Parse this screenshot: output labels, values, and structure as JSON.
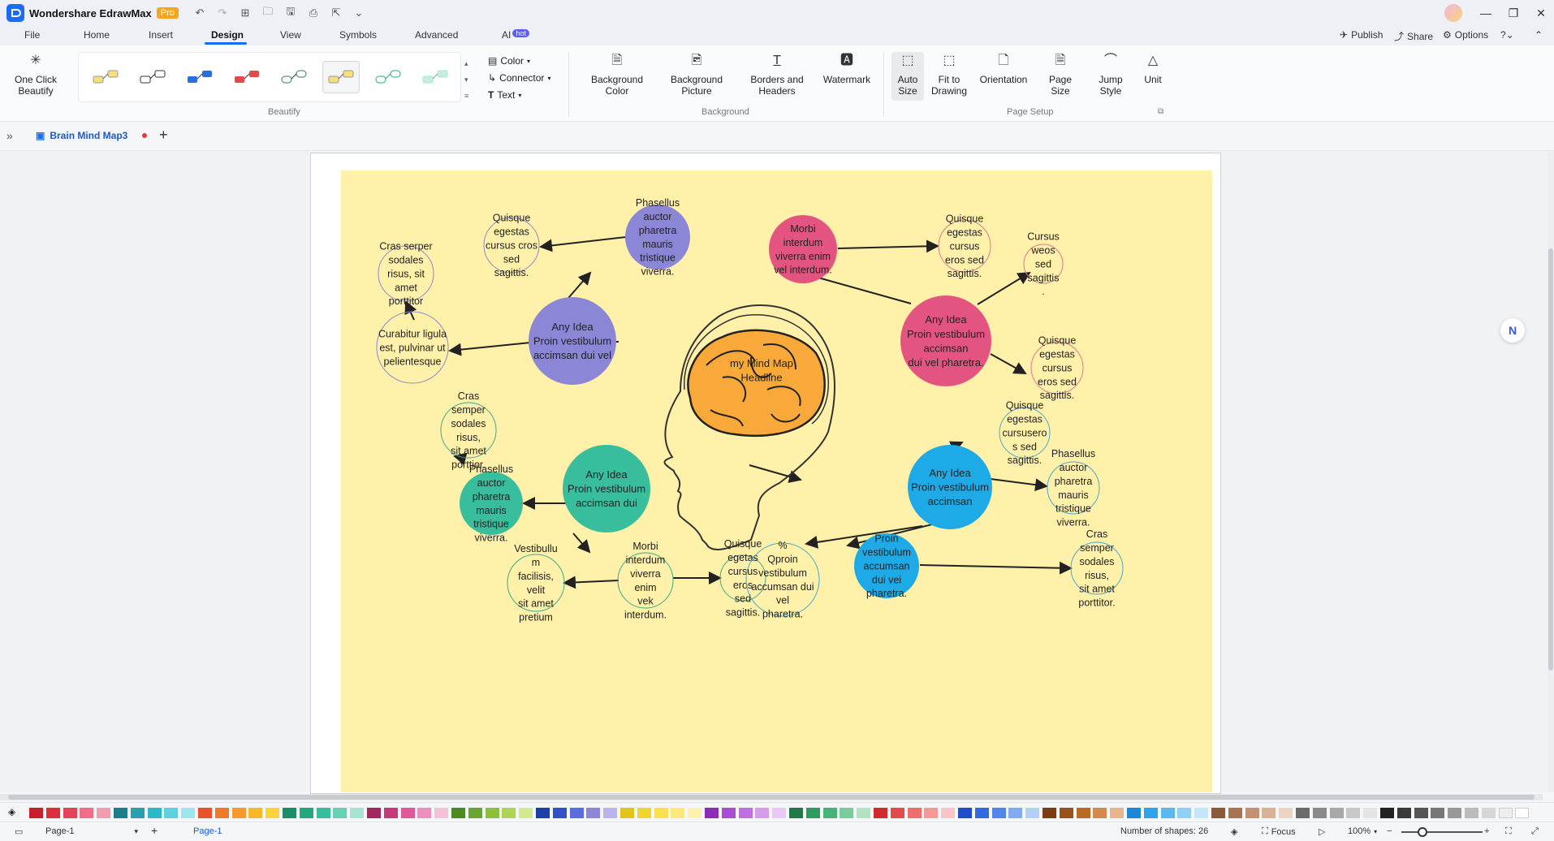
{
  "app": {
    "title": "Wondershare EdrawMax",
    "badge": "Pro"
  },
  "menu": {
    "tabs": [
      "File",
      "Home",
      "Insert",
      "Design",
      "View",
      "Symbols",
      "Advanced",
      "AI"
    ],
    "active": "Design",
    "ai_badge": "hot",
    "publish": "Publish",
    "share": "Share",
    "options": "Options"
  },
  "ribbon": {
    "one_click": "One Click\nBeautify",
    "color": "Color",
    "connector": "Connector",
    "text": "Text",
    "beautify_label": "Beautify",
    "bg_color": "Background\nColor",
    "bg_picture": "Background\nPicture",
    "borders": "Borders and\nHeaders",
    "watermark": "Watermark",
    "background_label": "Background",
    "auto_size": "Auto\nSize",
    "fit": "Fit to\nDrawing",
    "orientation": "Orientation",
    "page_size": "Page\nSize",
    "jump": "Jump\nStyle",
    "unit": "Unit",
    "page_setup_label": "Page Setup"
  },
  "document": {
    "tab": "Brain Mind Map3"
  },
  "mindmap": {
    "center": "my Mind Map\nHeadline",
    "nodes": [
      {
        "id": "p1",
        "text": "Any Idea\nProin vestibulum\naccimsan dui vel",
        "color": "#8b86d6",
        "text_color": "#222"
      },
      {
        "id": "p2",
        "text": "Any Idea\nProin vestibulum\naccimsan\ndui vel pharetra.",
        "color": "#e35580",
        "text_color": "#222"
      },
      {
        "id": "p3",
        "text": "Any Idea\nProin vestibulum\naccimsan dui",
        "color": "#38bd9d",
        "text_color": "#222"
      },
      {
        "id": "p4",
        "text": "Any Idea\nProin vestibulum\naccimsan",
        "color": "#1eaae6",
        "text_color": "#222"
      },
      {
        "id": "c1",
        "text": "Phasellus\nauctor\npharetra\nmauris\ntristique\nviverra.",
        "color": "#8b86d6"
      },
      {
        "id": "c2",
        "text": "Quisque\negestas\ncursus cros\nsed\nsagittis.",
        "color": "none"
      },
      {
        "id": "c3",
        "text": "Cras serper\nsodales\nrisus, sit\namet\nporttitor",
        "color": "none"
      },
      {
        "id": "c4",
        "text": "Curabitur ligula\nest, pulvinar ut\npelientesque",
        "color": "none"
      },
      {
        "id": "c5",
        "text": "Morbi\ninterdum\nviverra enim\nvel interdum.",
        "color": "#e35580"
      },
      {
        "id": "c6",
        "text": "Quisque\negestas\ncursus\neros sed\nsagittis.",
        "color": "none"
      },
      {
        "id": "c7",
        "text": "Cursus\nweos\nsed\nsagittis\n.",
        "color": "none"
      },
      {
        "id": "c8",
        "text": "Quisque\negestas\ncursus\neros sed\nsagittis.",
        "color": "none"
      },
      {
        "id": "c9",
        "text": "Cras\nsemper\nsodales\nrisus,\nsit amet\nporttior.",
        "color": "none"
      },
      {
        "id": "c10",
        "text": "Phasellus\nauctor\npharetra\nmauris\ntristique\nviverra.",
        "color": "#38bd9d"
      },
      {
        "id": "c11",
        "text": "Morbi\ninterdum\nviverra\nenim\nvek\ninterdum.",
        "color": "none"
      },
      {
        "id": "c12",
        "text": "Vestibullu\nm\nfacilisis,\nvelit\nsit amet\npretium",
        "color": "none"
      },
      {
        "id": "c13",
        "text": "Quisque\negetas\ncursus\neros\nsed\nsagittis.",
        "color": "none"
      },
      {
        "id": "c14",
        "text": "Quisque\negestas\ncursusero\ns sed\nsagittis.",
        "color": "none"
      },
      {
        "id": "c15",
        "text": "Phasellus\nauctor\npharetra\nmauris\ntristique\nviverra.",
        "color": "none"
      },
      {
        "id": "c16",
        "text": "%\nQproin\nvestibulum\naccumsan dui\nvel\npharetra.",
        "color": "none"
      },
      {
        "id": "c17",
        "text": "Proin\nvestibulum\naccumsan\ndui vei\npharetra.",
        "color": "#1eaae6"
      },
      {
        "id": "c18",
        "text": "Cras\nsemper\nsodales\nrisus,\nsit amet\nporttitor.",
        "color": "none"
      }
    ]
  },
  "palette": [
    "#c8202a",
    "#d9303c",
    "#e2455a",
    "#ef6f8a",
    "#f19cb0",
    "#1f7e8c",
    "#2a9fb2",
    "#2db7c9",
    "#5fd0df",
    "#9fe5ee",
    "#e8542a",
    "#f07a2c",
    "#f79a2c",
    "#f9b82a",
    "#fbd13c",
    "#1e8c6a",
    "#24a67e",
    "#38bd9d",
    "#69d0b6",
    "#a5e3d2",
    "#a0285c",
    "#c73a7a",
    "#de5b98",
    "#ec8fbd",
    "#f6c0d9",
    "#4c8a22",
    "#6aa532",
    "#8bbf3e",
    "#afd35a",
    "#d3e88f",
    "#1e3ea8",
    "#2f52c9",
    "#5a6ee0",
    "#8b86d6",
    "#b9b5ec",
    "#e6c21c",
    "#f2d42f",
    "#f8e04f",
    "#fbe97b",
    "#fdf2ad",
    "#8c2bb8",
    "#a94bd3",
    "#c06fe0",
    "#d49ceb",
    "#e8c8f4",
    "#22784a",
    "#2f9a5e",
    "#46b478",
    "#79cc9b",
    "#b1e2c4",
    "#d12a2a",
    "#e34a4a",
    "#ee6e6e",
    "#f49898",
    "#f9c4c4",
    "#1f4ec8",
    "#2e6ce0",
    "#4f88ea",
    "#80abf1",
    "#b4cff7",
    "#7a3c10",
    "#9a5218",
    "#bb6a24",
    "#d48a4c",
    "#e8b58c",
    "#1d86d6",
    "#2ea2ea",
    "#5bb9f0",
    "#8fd0f5",
    "#c3e6fa",
    "#8a5a3c",
    "#a97452",
    "#c49270",
    "#d8b296",
    "#ebd4c2",
    "#6b6b6b",
    "#8a8a8a",
    "#a8a8a8",
    "#c8c8c8",
    "#e4e4e4",
    "#222222",
    "#3a3a3a",
    "#555555",
    "#777777",
    "#999999",
    "#bbbbbb",
    "#d6d6d6",
    "#eeeeee",
    "#ffffff"
  ],
  "status": {
    "page_select": "Page-1",
    "page_tab": "Page-1",
    "shapes": "Number of shapes: 26",
    "focus": "Focus",
    "zoom": "100%"
  }
}
